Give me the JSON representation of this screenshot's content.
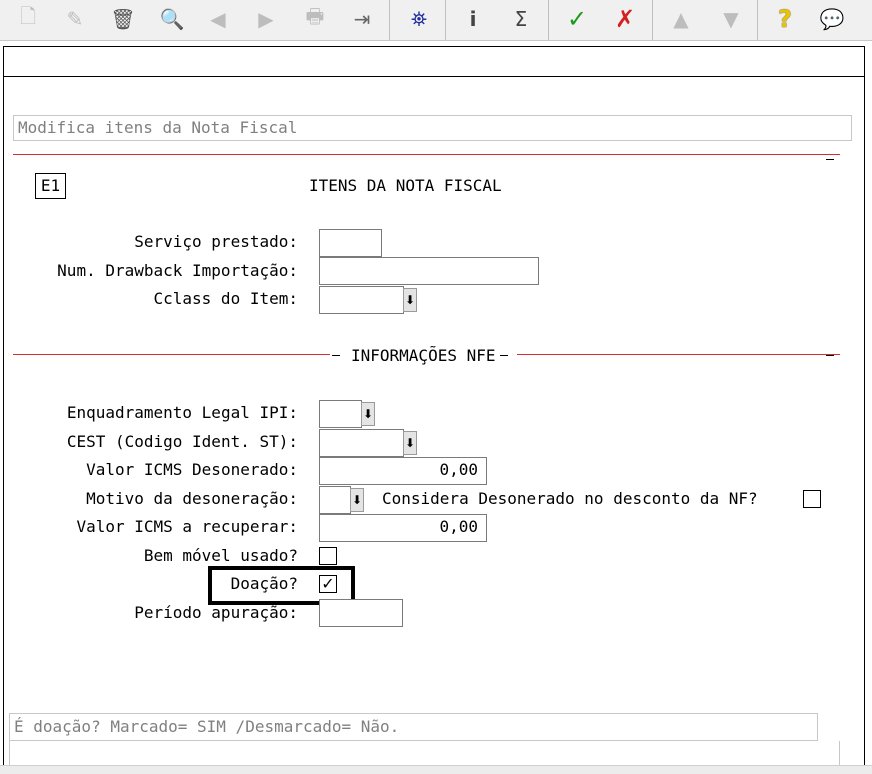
{
  "toolbar": {
    "icons": [
      "new-icon",
      "edit-icon",
      "delete-icon",
      "search-icon",
      "previous-icon",
      "next-icon",
      "print-icon",
      "exit-icon",
      "binoculars-icon",
      "info-icon",
      "sum-icon",
      "confirm-icon",
      "cancel-icon",
      "up-icon",
      "down-icon",
      "help-icon",
      "chat-icon"
    ],
    "glyphs": {
      "new": "🗋",
      "edit": "✎",
      "delete": "🗑",
      "search": "🔍",
      "previous": "◀",
      "next": "▶",
      "print": "🖶",
      "exit": "⇥",
      "binoculars": "⛯",
      "info": "i",
      "sum": "Σ",
      "confirm": "✓",
      "cancel": "✗",
      "up": "▲",
      "down": "▼",
      "help": "?",
      "chat": "💬"
    }
  },
  "form": {
    "title": "Modifica itens da Nota Fiscal",
    "screen_code": "E1",
    "section_title": "ITENS DA NOTA FISCAL",
    "fields": {
      "servico_label": "Serviço prestado:",
      "servico_value": "",
      "drawback_label": "Num. Drawback Importação:",
      "drawback_value": "",
      "cclass_label": "Cclass do Item:",
      "cclass_value": ""
    },
    "nfe_section": "INFORMAÇÕES NFE",
    "nfe": {
      "enquadramento_label": "Enquadramento Legal IPI:",
      "enquadramento_value": "",
      "cest_label": "CEST (Codigo Ident. ST):",
      "cest_value": "",
      "valor_icms_deson_label": "Valor ICMS Desonerado:",
      "valor_icms_deson_value": "0,00",
      "motivo_label": "Motivo da desoneração:",
      "motivo_value": "",
      "considera_label": "Considera Desonerado no desconto da NF?",
      "considera_checked": false,
      "valor_icms_recup_label": "Valor ICMS a recuperar:",
      "valor_icms_recup_value": "0,00",
      "bem_movel_label": "Bem móvel usado?",
      "bem_movel_checked": false,
      "doacao_label": "Doação?",
      "doacao_checked": true,
      "doacao_check_glyph": "✓",
      "periodo_label": "Período apuração:",
      "periodo_value": ""
    },
    "dropdown_glyph": "⬇",
    "help_text": "É doação? Marcado= SIM /Desmarcado= Não."
  },
  "colors": {
    "accent_line": "#d23030",
    "disabled_icon": "#bdbdbd",
    "confirm": "#1a9a1a",
    "cancel": "#d42020",
    "help": "#e8c400",
    "binoculars": "#2030a0"
  }
}
